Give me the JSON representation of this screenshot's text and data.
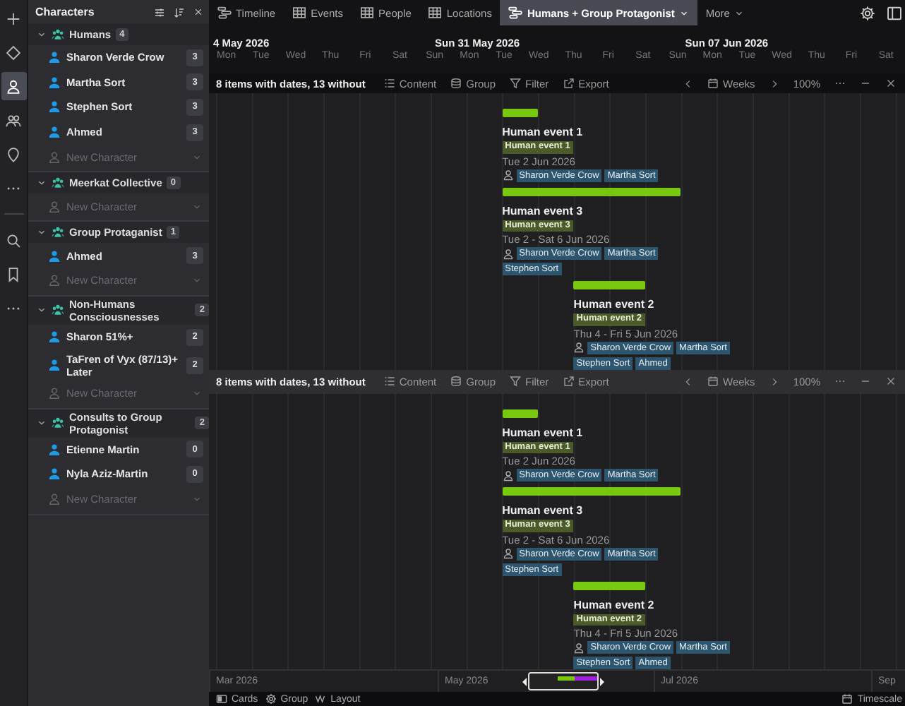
{
  "rail": {
    "top": [
      {
        "kind": "plus",
        "selected": false
      },
      {
        "kind": "diamond",
        "selected": false
      },
      {
        "kind": "person",
        "selected": true
      },
      {
        "kind": "people",
        "selected": false
      },
      {
        "kind": "pin",
        "selected": false
      },
      {
        "kind": "more",
        "selected": false
      }
    ],
    "bottom": [
      {
        "kind": "search",
        "selected": false
      },
      {
        "kind": "bookmark",
        "selected": false
      },
      {
        "kind": "more",
        "selected": false
      }
    ]
  },
  "sidebar": {
    "title": "Characters",
    "groups": [
      {
        "name": "Humans",
        "count": "4",
        "items": [
          {
            "name": "Sharon Verde Crow",
            "count": "3"
          },
          {
            "name": "Martha Sort",
            "count": "3"
          },
          {
            "name": "Stephen Sort",
            "count": "3"
          },
          {
            "name": "Ahmed",
            "count": "3"
          }
        ],
        "new_item": "New Character"
      },
      {
        "name": "Meerkat Collective",
        "count": "0",
        "new_item": "New Character"
      },
      {
        "name": "Group Protaganist",
        "count": "1",
        "items": [
          {
            "name": "Ahmed",
            "count": "3"
          }
        ],
        "new_item": "New Character"
      },
      {
        "name": "Non-Humans Consciousnesses",
        "count": "2",
        "items": [
          {
            "name": "Sharon 51%+",
            "count": "2"
          },
          {
            "name": "TaFren of Vyx (87/13)+ Later",
            "count": "2"
          }
        ],
        "new_item": "New Character"
      },
      {
        "name": "Consults to Group Protagonist",
        "count": "2",
        "items": [
          {
            "name": "Etienne Martin",
            "count": "0"
          },
          {
            "name": "Nyla Aziz-Martin",
            "count": "0"
          }
        ],
        "new_item": "New Character"
      }
    ]
  },
  "tabs": [
    {
      "label": "Timeline",
      "kind": "timeline",
      "selected": false,
      "dropdown": false
    },
    {
      "label": "Events",
      "kind": "table",
      "selected": false,
      "dropdown": false
    },
    {
      "label": "People",
      "kind": "table",
      "selected": false,
      "dropdown": false
    },
    {
      "label": "Locations",
      "kind": "table",
      "selected": false,
      "dropdown": false
    },
    {
      "label": "Humans + Group Protagonist",
      "kind": "timeline",
      "selected": true,
      "dropdown": true
    },
    {
      "label": "More",
      "kind": "plain",
      "selected": false,
      "dropdown": true
    }
  ],
  "header": {
    "weeks": [
      "4 May 2026",
      "Sun 31 May 2026",
      "Sun 07 Jun 2026"
    ],
    "days": [
      "Mon",
      "Tue",
      "Wed",
      "Thu",
      "Fri",
      "Sat",
      "Sun",
      "Mon",
      "Tue",
      "Wed",
      "Thu",
      "Fri",
      "Sat",
      "Sun",
      "Mon",
      "Tue",
      "Wed",
      "Thu",
      "Fri",
      "Sat"
    ]
  },
  "panels": [
    {
      "active": true,
      "toolbar": {
        "summary": "8 items with dates, 13 without",
        "content": "Content",
        "group": "Group",
        "filter": "Filter",
        "export": "Export",
        "scale": "Weeks",
        "zoom": "100%"
      },
      "events": [
        {
          "title": "Human event 1",
          "tag": "Human event 1",
          "date": "Tue 2 Jun 2026",
          "people": [
            "Sharon Verde Crow",
            "Martha Sort"
          ]
        },
        {
          "title": "Human event 3",
          "tag": "Human event 3",
          "date": "Tue 2 - Sat 6 Jun 2026",
          "people": [
            "Sharon Verde Crow",
            "Martha Sort",
            "Stephen Sort"
          ]
        },
        {
          "title": "Human event 2",
          "tag": "Human event 2",
          "date": "Thu 4 - Fri 5 Jun 2026",
          "people": [
            "Sharon Verde Crow",
            "Martha Sort",
            "Stephen Sort",
            "Ahmed"
          ]
        }
      ]
    },
    {
      "active": false,
      "toolbar": {
        "summary": "8 items with dates, 13 without",
        "content": "Content",
        "group": "Group",
        "filter": "Filter",
        "export": "Export",
        "scale": "Weeks",
        "zoom": "100%"
      },
      "events": [
        {
          "title": "Human event 1",
          "tag": "Human event 1",
          "date": "Tue 2 Jun 2026",
          "people": [
            "Sharon Verde Crow",
            "Martha Sort"
          ]
        },
        {
          "title": "Human event 3",
          "tag": "Human event 3",
          "date": "Tue 2 - Sat 6 Jun 2026",
          "people": [
            "Sharon Verde Crow",
            "Martha Sort",
            "Stephen Sort"
          ]
        },
        {
          "title": "Human event 2",
          "tag": "Human event 2",
          "date": "Thu 4 - Fri 5 Jun 2026",
          "people": [
            "Sharon Verde Crow",
            "Martha Sort",
            "Stephen Sort",
            "Ahmed"
          ]
        }
      ]
    }
  ],
  "overview": {
    "months": [
      "Mar 2026",
      "May 2026",
      "Jul 2026",
      "Sep"
    ]
  },
  "status_bar": {
    "cards": "Cards",
    "group": "Group",
    "layout": "Layout",
    "timescale": "Timescale"
  }
}
